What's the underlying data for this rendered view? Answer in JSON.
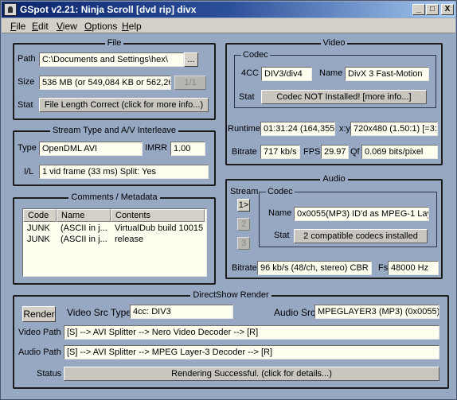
{
  "window": {
    "title": "GSpot v2.21: Ninja Scroll [dvd rip] divx",
    "minimize": "_",
    "maximize": "□",
    "close": "X"
  },
  "menu": [
    "File",
    "Edit",
    "View",
    "Options",
    "Help"
  ],
  "file": {
    "group_title": "File",
    "path_label": "Path",
    "path_value": "C:\\Documents and Settings\\hex\\",
    "browse_label": "...",
    "size_label": "Size",
    "size_value": "536 MB (or 549,084 KB or 562,26",
    "part_label": "1/1",
    "stat_label": "Stat",
    "stat_button": "File Length Correct (click for more info...)"
  },
  "stream": {
    "group_title": "Stream Type and A/V Interleave",
    "type_label": "Type",
    "type_value": "OpenDML AVI",
    "imrr_label": "IMRR",
    "imrr_value": "1.00",
    "il_label": "I/L",
    "il_value": "1 vid frame (33 ms)  Split: Yes"
  },
  "comments": {
    "group_title": "Comments / Metadata",
    "columns": [
      "Code",
      "Name",
      "Contents"
    ],
    "rows": [
      {
        "code": "JUNK",
        "name": "(ASCII in j...",
        "contents": "VirtualDub build 10015"
      },
      {
        "code": "JUNK",
        "name": "(ASCII in j...",
        "contents": "release"
      }
    ]
  },
  "video": {
    "group_title": "Video",
    "codec_title": "Codec",
    "fourcc_label": "4CC",
    "fourcc_value": "DIV3/div4",
    "name_label": "Name",
    "name_value": "DivX 3 Fast-Motion",
    "stat_label": "Stat",
    "stat_button": "Codec NOT Installed!  [more info...]",
    "runtime_label": "Runtime",
    "runtime_value": "01:31:24 (164,355",
    "xy_label": "x:y",
    "xy_value": "720x480 (1.50:1) [=3:",
    "bitrate_label": "Bitrate",
    "bitrate_value": "717 kb/s",
    "fps_label": "FPS",
    "fps_value": "29.97",
    "qf_label": "Qf",
    "qf_value": "0.069 bits/pixel"
  },
  "audio": {
    "group_title": "Audio",
    "stream_label": "Stream",
    "stream_buttons": [
      "1>",
      "2",
      "3"
    ],
    "codec_title": "Codec",
    "name_label": "Name",
    "name_value": "0x0055(MP3) ID'd as MPEG-1 Lay",
    "stat_label": "Stat",
    "stat_button": "2 compatible codecs installed",
    "bitrate_label": "Bitrate",
    "bitrate_value": "96 kb/s (48/ch, stereo) CBR",
    "fs_label": "Fs",
    "fs_value": "48000 Hz"
  },
  "directshow": {
    "group_title": "DirectShow Render",
    "render_button": "Render",
    "video_src_label": "Video Src Type",
    "video_src_value": "4cc: DIV3",
    "audio_src_label": "Audio Src",
    "audio_src_value": "MPEGLAYER3 (MP3) (0x0055)",
    "video_path_label": "Video Path",
    "video_path_value": "[S] --> AVI Splitter --> Nero Video Decoder --> [R]",
    "audio_path_label": "Audio Path",
    "audio_path_value": "[S] --> AVI Splitter --> MPEG Layer-3 Decoder --> [R]",
    "status_label": "Status",
    "status_button": "Rendering Successful.  (click for details...)"
  }
}
